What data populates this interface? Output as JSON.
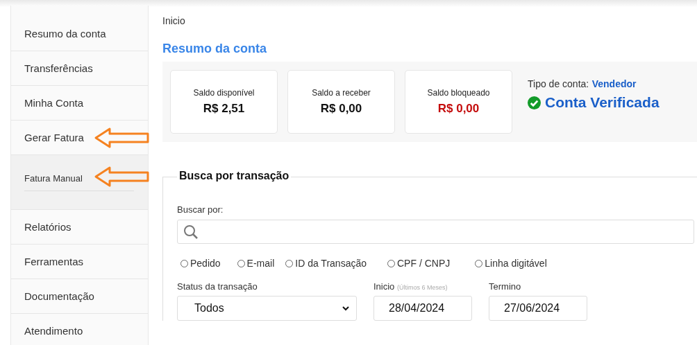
{
  "sidebar": {
    "items": [
      {
        "label": "Resumo da conta"
      },
      {
        "label": "Transferências"
      },
      {
        "label": "Minha Conta"
      },
      {
        "label": "Gerar Fatura",
        "expanded": true,
        "annotated": true,
        "children": [
          {
            "label": "Fatura Manual",
            "annotated": true
          }
        ]
      },
      {
        "label": "Relatórios"
      },
      {
        "label": "Ferramentas"
      },
      {
        "label": "Documentação"
      },
      {
        "label": "Atendimento"
      }
    ]
  },
  "breadcrumb": "Inicio",
  "page_title": "Resumo da conta",
  "balances": [
    {
      "label": "Saldo disponível",
      "value": "R$ 2,51",
      "negative": false
    },
    {
      "label": "Saldo a receber",
      "value": "R$ 0,00",
      "negative": false
    },
    {
      "label": "Saldo bloqueado",
      "value": "R$ 0,00",
      "negative": true
    }
  ],
  "account": {
    "type_label": "Tipo de conta:",
    "type_value": "Vendedor",
    "status": "Conta Verificada",
    "verified": true
  },
  "search": {
    "legend": "Busca por transação",
    "label": "Buscar por:",
    "options": [
      {
        "label": "Pedido",
        "selected": false
      },
      {
        "label": "E-mail",
        "selected": false
      },
      {
        "label": "ID da Transação",
        "selected": false
      },
      {
        "label": "CPF / CNPJ",
        "selected": false
      },
      {
        "label": "Linha digitável",
        "selected": false
      }
    ],
    "status_label": "Status da transação",
    "status_value": "Todos",
    "start_label": "Inicio",
    "start_hint": "(Últimos 6 Meses)",
    "start_value": "28/04/2024",
    "end_label": "Termino",
    "end_value": "27/06/2024"
  }
}
